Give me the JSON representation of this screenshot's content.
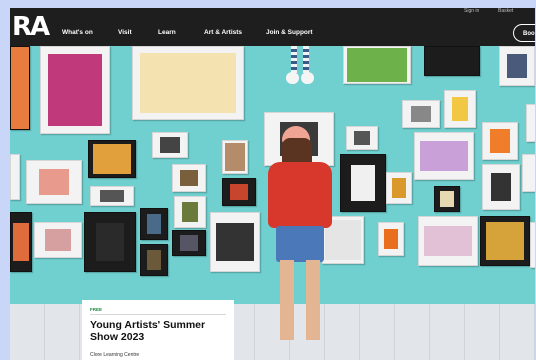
{
  "header": {
    "logo": "RA",
    "nav": [
      "What's on",
      "Visit",
      "Learn",
      "Art & Artists",
      "Join & Support"
    ],
    "utility": [
      "Sign in",
      "Basket"
    ],
    "book_button": "Book"
  },
  "hero": {
    "tag": "FREE",
    "title": "Young Artists' Summer Show 2023",
    "venue": "Clore Learning Centre"
  },
  "colors": {
    "header_bg": "#1e1e1e",
    "wall": "#6fd0cf",
    "tag_green": "#1a8c3c",
    "page_bg": "#c9d6f7"
  }
}
